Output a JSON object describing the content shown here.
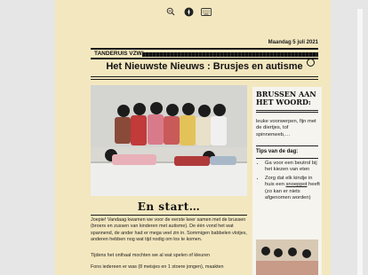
{
  "viewer": {
    "toolbar": [
      {
        "icon": "zoom-out-icon"
      },
      {
        "icon": "compass-icon"
      },
      {
        "icon": "keyboard-icon"
      }
    ]
  },
  "newspaper": {
    "date": "Maandag 5 juli 2021",
    "publisher": "TANDERUIS VZW/",
    "headline": "Het Nieuwste Nieuws : Brusjes en autisme",
    "section_title": "En start…",
    "paragraphs": [
      "Joepie! Vandaag kwamen we voor de eerste keer samen met de brussen (broers en zussen van kinderen met autisme). De één vond het wat spannend, de ander had er mega veel zin in. Sommigen babbelen vlotjes, anderen hebben nog wat tijd nodig om los te komen.",
      "Tijdens het onthaal mochten we al wat spelen of kleuren",
      "Fons iedereen er was (8 meisjes en 1 stoere jongen), maakten"
    ]
  },
  "sidebar": {
    "title": "BRUSSEN AAN HET WOORD:",
    "quote": "leuke voorwerpen, fijn met de diertjes, tof spinnenweb,…",
    "tips_title": "Tips van de dag:",
    "tips": [
      {
        "text": "Ga voor een beutrol bij het kiezen van eten"
      },
      {
        "before": "Zorg dat elk kindje in huis een ",
        "underlined": "snoeppot",
        "after": " heeft (zo kan er niets afgenomen worden)"
      }
    ]
  }
}
